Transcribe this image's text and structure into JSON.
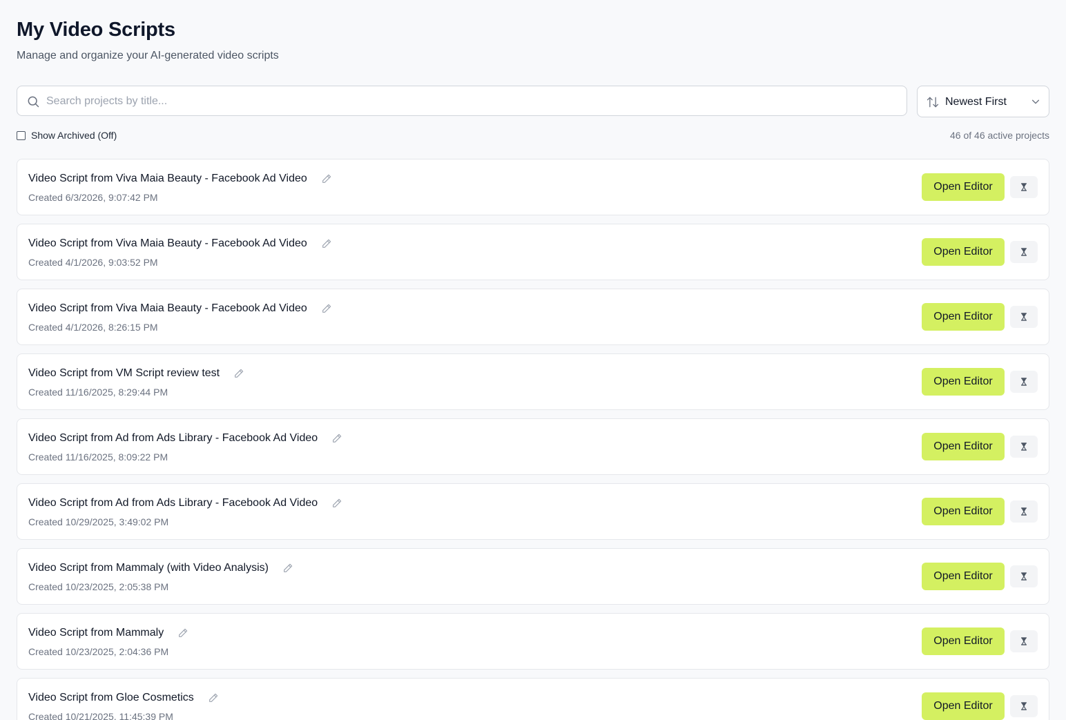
{
  "header": {
    "title": "My Video Scripts",
    "subtitle": "Manage and organize your AI-generated video scripts"
  },
  "search": {
    "placeholder": "Search projects by title...",
    "value": ""
  },
  "sort": {
    "selected": "Newest First"
  },
  "filters": {
    "show_archived_label": "Show Archived (Off)",
    "show_archived_checked": false
  },
  "summary": {
    "count_text": "46 of 46 active projects"
  },
  "actions": {
    "open_label": "Open Editor"
  },
  "projects": [
    {
      "title": "Video Script from Viva Maia Beauty - Facebook Ad Video",
      "created": "Created 6/3/2026, 9:07:42 PM"
    },
    {
      "title": "Video Script from Viva Maia Beauty - Facebook Ad Video",
      "created": "Created 4/1/2026, 9:03:52 PM"
    },
    {
      "title": "Video Script from Viva Maia Beauty - Facebook Ad Video",
      "created": "Created 4/1/2026, 8:26:15 PM"
    },
    {
      "title": "Video Script from VM Script review test",
      "created": "Created 11/16/2025, 8:29:44 PM"
    },
    {
      "title": "Video Script from Ad from Ads Library - Facebook Ad Video",
      "created": "Created 11/16/2025, 8:09:22 PM"
    },
    {
      "title": "Video Script from Ad from Ads Library - Facebook Ad Video",
      "created": "Created 10/29/2025, 3:49:02 PM"
    },
    {
      "title": "Video Script from Mammaly (with Video Analysis)",
      "created": "Created 10/23/2025, 2:05:38 PM"
    },
    {
      "title": "Video Script from Mammaly",
      "created": "Created 10/23/2025, 2:04:36 PM"
    },
    {
      "title": "Video Script from Gloe Cosmetics",
      "created": "Created 10/21/2025, 11:45:39 PM"
    }
  ],
  "colors": {
    "accent": "#d4f061",
    "background": "#f8f9fb",
    "card_border": "#e5e7eb",
    "muted_text": "#6b7280"
  },
  "icons": {
    "search": "search-icon",
    "sort": "sort-arrows-icon",
    "dropdown": "chevron-down-icon",
    "edit": "pencil-icon",
    "archive": "hourglass-icon"
  }
}
